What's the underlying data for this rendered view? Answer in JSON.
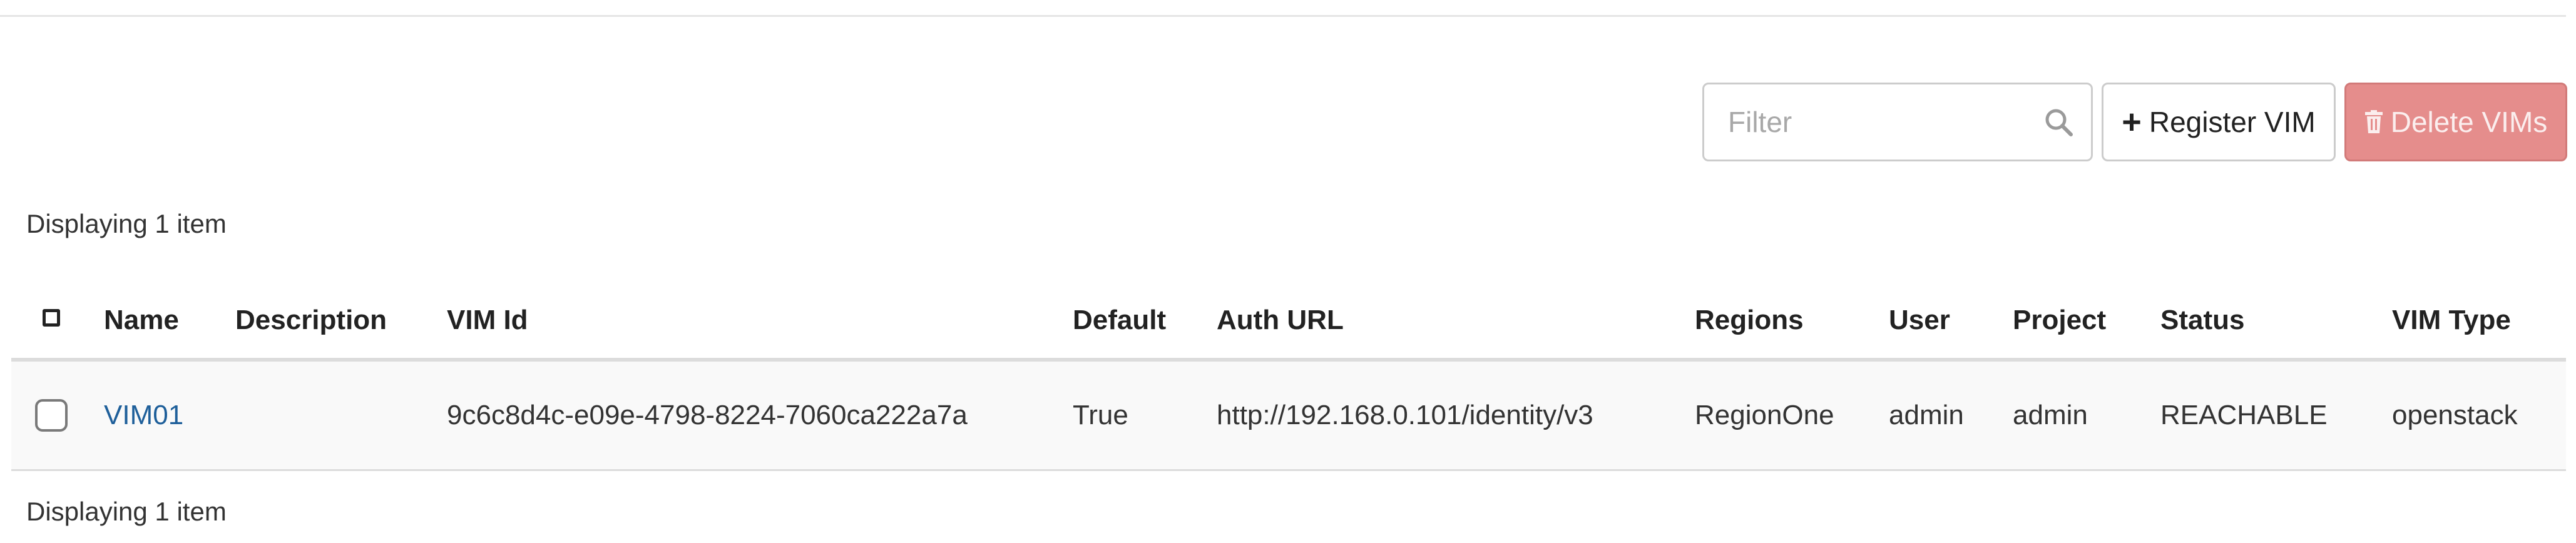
{
  "toolbar": {
    "filter_placeholder": "Filter",
    "search_icon": "search-icon",
    "register_label": "Register VIM",
    "register_icon": "plus-icon",
    "delete_label": "Delete VIMs",
    "delete_icon": "trash-icon"
  },
  "count_label_top": "Displaying 1 item",
  "count_label_bottom": "Displaying 1 item",
  "table": {
    "columns": [
      "Name",
      "Description",
      "VIM Id",
      "Default",
      "Auth URL",
      "Regions",
      "User",
      "Project",
      "Status",
      "VIM Type"
    ],
    "rows": [
      {
        "name": "VIM01",
        "description": "",
        "vim_id": "9c6c8d4c-e09e-4798-8224-7060ca222a7a",
        "default": "True",
        "auth_url": "http://192.168.0.101/identity/v3",
        "regions": "RegionOne",
        "user": "admin",
        "project": "admin",
        "status": "REACHABLE",
        "vim_type": "openstack"
      }
    ]
  },
  "colors": {
    "link": "#1e5f9a",
    "danger_button": "#e58d8c",
    "border": "#cccccc"
  }
}
